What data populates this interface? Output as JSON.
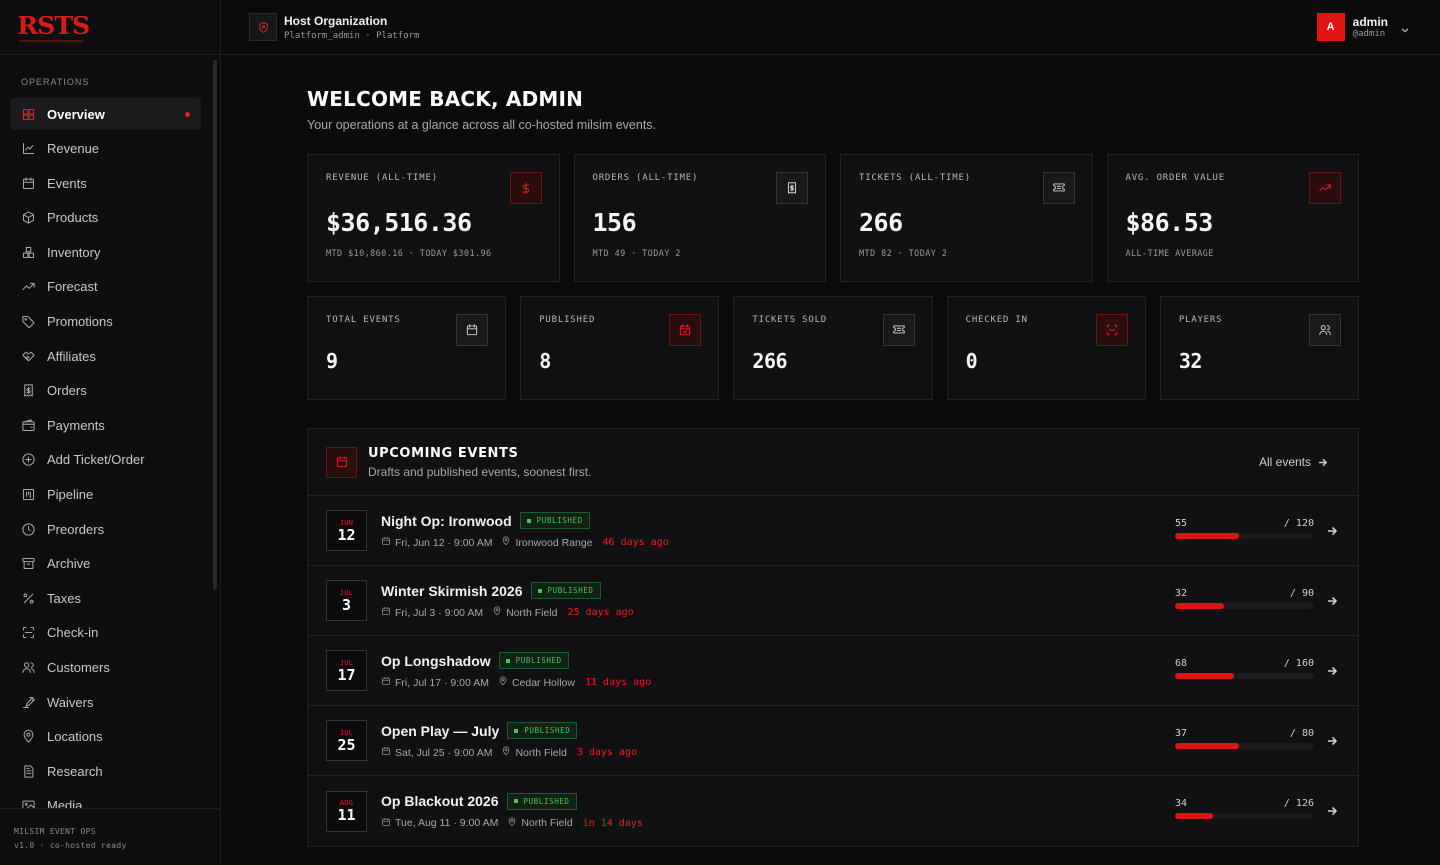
{
  "brand": {
    "logo": "RSTS",
    "accent": "#e01414"
  },
  "sidebar": {
    "section_label": "OPERATIONS",
    "items": [
      {
        "label": "Overview",
        "icon": "grid-icon",
        "active": true
      },
      {
        "label": "Revenue",
        "icon": "line-chart-icon"
      },
      {
        "label": "Events",
        "icon": "calendar-icon"
      },
      {
        "label": "Products",
        "icon": "box-icon"
      },
      {
        "label": "Inventory",
        "icon": "boxes-icon"
      },
      {
        "label": "Forecast",
        "icon": "trending-up-icon"
      },
      {
        "label": "Promotions",
        "icon": "tag-icon"
      },
      {
        "label": "Affiliates",
        "icon": "handshake-icon"
      },
      {
        "label": "Orders",
        "icon": "receipt-icon"
      },
      {
        "label": "Payments",
        "icon": "wallet-icon"
      },
      {
        "label": "Add Ticket/Order",
        "icon": "plus-circle-icon"
      },
      {
        "label": "Pipeline",
        "icon": "kanban-icon"
      },
      {
        "label": "Preorders",
        "icon": "clock-icon"
      },
      {
        "label": "Archive",
        "icon": "archive-icon"
      },
      {
        "label": "Taxes",
        "icon": "percent-icon"
      },
      {
        "label": "Check-in",
        "icon": "scan-icon"
      },
      {
        "label": "Customers",
        "icon": "users-icon"
      },
      {
        "label": "Waivers",
        "icon": "signature-icon"
      },
      {
        "label": "Locations",
        "icon": "map-pin-icon"
      },
      {
        "label": "Research",
        "icon": "document-icon"
      },
      {
        "label": "Media",
        "icon": "image-icon"
      }
    ],
    "footer": {
      "line1": "MILSIM EVENT OPS",
      "line2": "v1.0 · co-hosted ready"
    }
  },
  "topbar": {
    "org_name": "Host Organization",
    "org_sub": "Platform_admin · Platform",
    "user": {
      "initial": "A",
      "name": "admin",
      "handle": "@admin"
    }
  },
  "main": {
    "title": "WELCOME BACK, ADMIN",
    "subtitle": "Your operations at a glance across all co-hosted milsim events."
  },
  "stats_top": [
    {
      "label": "REVENUE (ALL-TIME)",
      "value": "$36,516.36",
      "sub": "MTD $10,860.16 · TODAY $301.96",
      "icon": "dollar-icon",
      "red": true
    },
    {
      "label": "ORDERS (ALL-TIME)",
      "value": "156",
      "sub": "MTD 49 · TODAY 2",
      "icon": "receipt-icon",
      "red": false
    },
    {
      "label": "TICKETS (ALL-TIME)",
      "value": "266",
      "sub": "MTD 82 · TODAY 2",
      "icon": "ticket-icon",
      "red": false
    },
    {
      "label": "AVG. ORDER VALUE",
      "value": "$86.53",
      "sub": "ALL-TIME AVERAGE",
      "icon": "trending-up-icon",
      "red": true
    }
  ],
  "stats_bottom": [
    {
      "label": "TOTAL EVENTS",
      "value": "9",
      "icon": "calendar-icon",
      "red": false
    },
    {
      "label": "PUBLISHED",
      "value": "8",
      "icon": "calendar-check-icon",
      "red": true
    },
    {
      "label": "TICKETS SOLD",
      "value": "266",
      "icon": "ticket-icon",
      "red": false
    },
    {
      "label": "CHECKED IN",
      "value": "0",
      "icon": "scan-icon",
      "red": true
    },
    {
      "label": "PLAYERS",
      "value": "32",
      "icon": "users-icon",
      "red": false
    }
  ],
  "upcoming": {
    "title": "UPCOMING EVENTS",
    "subtitle": "Drafts and published events, soonest first.",
    "all_label": "All events",
    "events": [
      {
        "month": "JUN",
        "day": "12",
        "name": "Night Op: Ironwood",
        "status": "PUBLISHED",
        "date": "Fri, Jun 12 · 9:00 AM",
        "location": "Ironwood Range",
        "relative": "46 days ago",
        "sold": "55",
        "capacity": "/ 120",
        "fill": 0.458
      },
      {
        "month": "JUL",
        "day": "3",
        "name": "Winter Skirmish 2026",
        "status": "PUBLISHED",
        "date": "Fri, Jul 3 · 9:00 AM",
        "location": "North Field",
        "relative": "25 days ago",
        "sold": "32",
        "capacity": "/ 90",
        "fill": 0.356
      },
      {
        "month": "JUL",
        "day": "17",
        "name": "Op Longshadow",
        "status": "PUBLISHED",
        "date": "Fri, Jul 17 · 9:00 AM",
        "location": "Cedar Hollow",
        "relative": "11 days ago",
        "sold": "68",
        "capacity": "/ 160",
        "fill": 0.425
      },
      {
        "month": "JUL",
        "day": "25",
        "name": "Open Play — July",
        "status": "PUBLISHED",
        "date": "Sat, Jul 25 · 9:00 AM",
        "location": "North Field",
        "relative": "3 days ago",
        "sold": "37",
        "capacity": "/ 80",
        "fill": 0.4625
      },
      {
        "month": "AUG",
        "day": "11",
        "name": "Op Blackout 2026",
        "status": "PUBLISHED",
        "date": "Tue, Aug 11 · 9:00 AM",
        "location": "North Field",
        "relative": "in 14 days",
        "sold": "34",
        "capacity": "/ 126",
        "fill": 0.27
      }
    ]
  }
}
